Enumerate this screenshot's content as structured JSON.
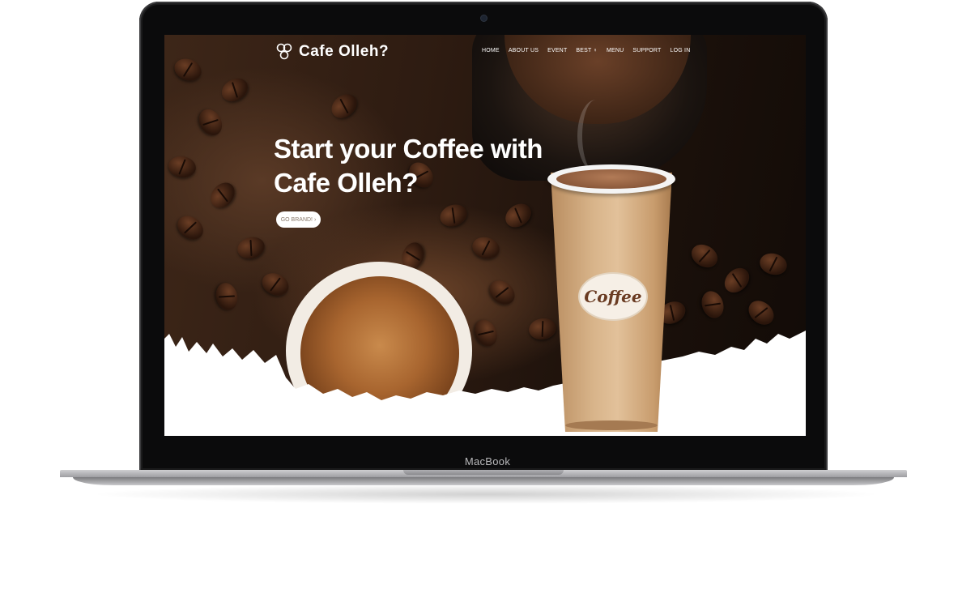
{
  "device": {
    "brand_label": "MacBook"
  },
  "site": {
    "logo_text": "Cafe Olleh?",
    "nav": [
      "HOME",
      "ABOUT US",
      "EVENT",
      "BEST ♀",
      "MENU",
      "SUPPORT",
      "LOG IN"
    ],
    "hero_title_line1": "Start your Coffee with",
    "hero_title_line2": "Cafe Olleh?",
    "cta_label": "GO BRAND! ›",
    "cup_label": "Coffee"
  },
  "colors": {
    "frame": "#0b0b0c",
    "hero_dark": "#2a1a12",
    "cup": "#d8b48a",
    "text": "#ffffff"
  }
}
